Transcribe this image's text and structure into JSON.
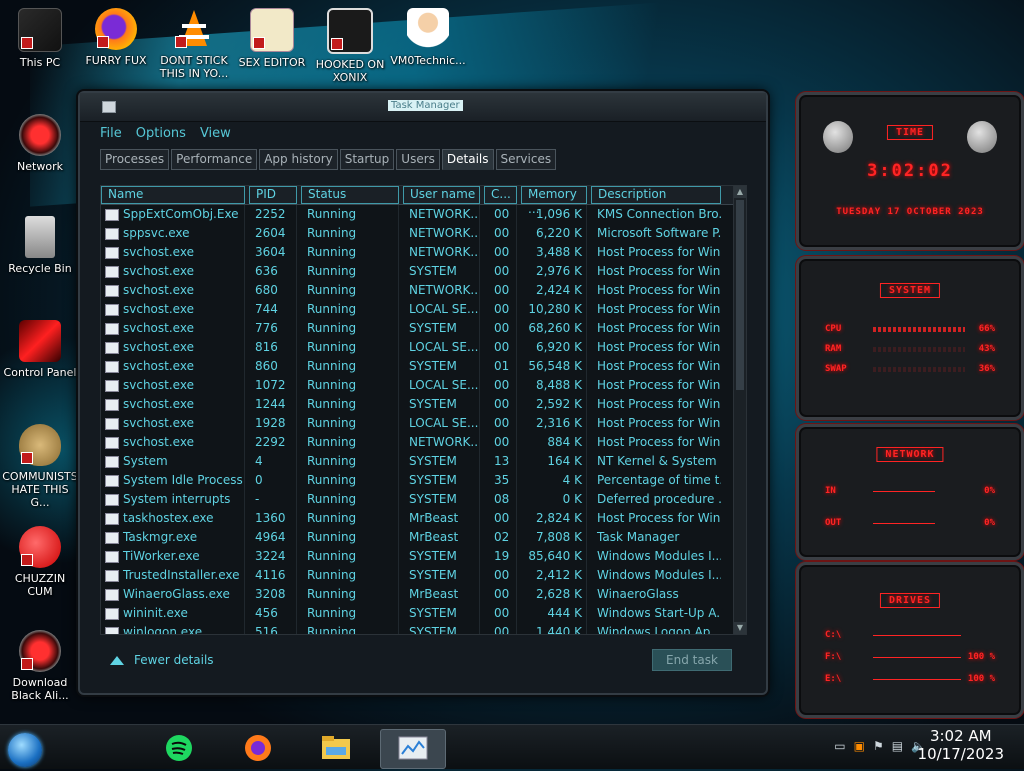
{
  "desktop_icons": [
    {
      "label": "This PC",
      "icon": "pc-icon"
    },
    {
      "label": "FURRY FUX",
      "icon": "firefox-icon"
    },
    {
      "label": "DONT STICK THIS IN YO...",
      "icon": "vlc-cone-icon"
    },
    {
      "label": "SEX EDITOR",
      "icon": "hex-editor-icon"
    },
    {
      "label": "HOOKED ON XONIX",
      "icon": "xonix-icon"
    },
    {
      "label": "VM0Technic...",
      "icon": "doctor-icon"
    },
    {
      "label": "Network",
      "icon": "network-icon"
    },
    {
      "label": "Recycle Bin",
      "icon": "recycle-bin-icon"
    },
    {
      "label": "Control Panel",
      "icon": "control-panel-icon"
    },
    {
      "label": "COMMUNISTS HATE THIS G...",
      "icon": "money-bag-icon"
    },
    {
      "label": "CHUZZIN CUM",
      "icon": "chuzzle-icon"
    },
    {
      "label": "Download Black Ali...",
      "icon": "alien-download-icon"
    }
  ],
  "window": {
    "title": "Task Manager",
    "menu": [
      "File",
      "Options",
      "View"
    ],
    "tabs": [
      "Processes",
      "Performance",
      "App history",
      "Startup",
      "Users",
      "Details",
      "Services"
    ],
    "active_tab": "Details",
    "columns": [
      "Name",
      "PID",
      "Status",
      "User name",
      "C...",
      "Memory ...",
      "Description"
    ],
    "rows": [
      [
        "SppExtComObj.Exe",
        "2252",
        "Running",
        "NETWORK...",
        "00",
        "1,096 K",
        "KMS Connection Bro..."
      ],
      [
        "sppsvc.exe",
        "2604",
        "Running",
        "NETWORK...",
        "00",
        "6,220 K",
        "Microsoft Software P..."
      ],
      [
        "svchost.exe",
        "3604",
        "Running",
        "NETWORK...",
        "00",
        "3,488 K",
        "Host Process for Win..."
      ],
      [
        "svchost.exe",
        "636",
        "Running",
        "SYSTEM",
        "00",
        "2,976 K",
        "Host Process for Win..."
      ],
      [
        "svchost.exe",
        "680",
        "Running",
        "NETWORK...",
        "00",
        "2,424 K",
        "Host Process for Win..."
      ],
      [
        "svchost.exe",
        "744",
        "Running",
        "LOCAL SE...",
        "00",
        "10,280 K",
        "Host Process for Win..."
      ],
      [
        "svchost.exe",
        "776",
        "Running",
        "SYSTEM",
        "00",
        "68,260 K",
        "Host Process for Win..."
      ],
      [
        "svchost.exe",
        "816",
        "Running",
        "LOCAL SE...",
        "00",
        "6,920 K",
        "Host Process for Win..."
      ],
      [
        "svchost.exe",
        "860",
        "Running",
        "SYSTEM",
        "01",
        "56,548 K",
        "Host Process for Win..."
      ],
      [
        "svchost.exe",
        "1072",
        "Running",
        "LOCAL SE...",
        "00",
        "8,488 K",
        "Host Process for Win..."
      ],
      [
        "svchost.exe",
        "1244",
        "Running",
        "SYSTEM",
        "00",
        "2,592 K",
        "Host Process for Win..."
      ],
      [
        "svchost.exe",
        "1928",
        "Running",
        "LOCAL SE...",
        "00",
        "2,316 K",
        "Host Process for Win..."
      ],
      [
        "svchost.exe",
        "2292",
        "Running",
        "NETWORK...",
        "00",
        "884 K",
        "Host Process for Win..."
      ],
      [
        "System",
        "4",
        "Running",
        "SYSTEM",
        "13",
        "164 K",
        "NT Kernel & System"
      ],
      [
        "System Idle Process",
        "0",
        "Running",
        "SYSTEM",
        "35",
        "4 K",
        "Percentage of time t..."
      ],
      [
        "System interrupts",
        "-",
        "Running",
        "SYSTEM",
        "08",
        "0 K",
        "Deferred procedure ..."
      ],
      [
        "taskhostex.exe",
        "1360",
        "Running",
        "MrBeast",
        "00",
        "2,824 K",
        "Host Process for Win..."
      ],
      [
        "Taskmgr.exe",
        "4964",
        "Running",
        "MrBeast",
        "02",
        "7,808 K",
        "Task Manager"
      ],
      [
        "TiWorker.exe",
        "3224",
        "Running",
        "SYSTEM",
        "19",
        "85,640 K",
        "Windows Modules I..."
      ],
      [
        "TrustedInstaller.exe",
        "4116",
        "Running",
        "SYSTEM",
        "00",
        "2,412 K",
        "Windows Modules I..."
      ],
      [
        "WinaeroGlass.exe",
        "3208",
        "Running",
        "MrBeast",
        "00",
        "2,628 K",
        "WinaeroGlass"
      ],
      [
        "wininit.exe",
        "456",
        "Running",
        "SYSTEM",
        "00",
        "444 K",
        "Windows Start-Up A..."
      ],
      [
        "winlogon.exe",
        "516",
        "Running",
        "SYSTEM",
        "00",
        "1,440 K",
        "Windows Logon Ap..."
      ]
    ],
    "fewer_details": "Fewer details",
    "end_task": "End task"
  },
  "widgets": {
    "time_label": "TIME",
    "time": "3:02:02",
    "date": "TUESDAY 17 OCTOBER 2023",
    "sys_label": "SYSTEM",
    "cpu_label": "CPU",
    "cpu": "66%",
    "ram_label": "RAM",
    "ram": "43%",
    "swap_label": "SWAP",
    "swap": "36%",
    "net_label": "NETWORK",
    "in_label": "IN",
    "in": "0%",
    "out_label": "OUT",
    "out": "0%",
    "drives_label": "DRIVES",
    "drives": [
      {
        "label": "C:\\",
        "value": ""
      },
      {
        "label": "F:\\",
        "value": "100 %"
      },
      {
        "label": "E:\\",
        "value": "100 %"
      }
    ]
  },
  "taskbar": {
    "apps": [
      "spotify-icon",
      "firefox-icon",
      "file-explorer-icon",
      "task-manager-icon"
    ],
    "clock_time": "3:02 AM",
    "clock_date": "10/17/2023",
    "colors": {
      "accent": "#5fd3e3",
      "widget_red": "#ff2424"
    }
  }
}
